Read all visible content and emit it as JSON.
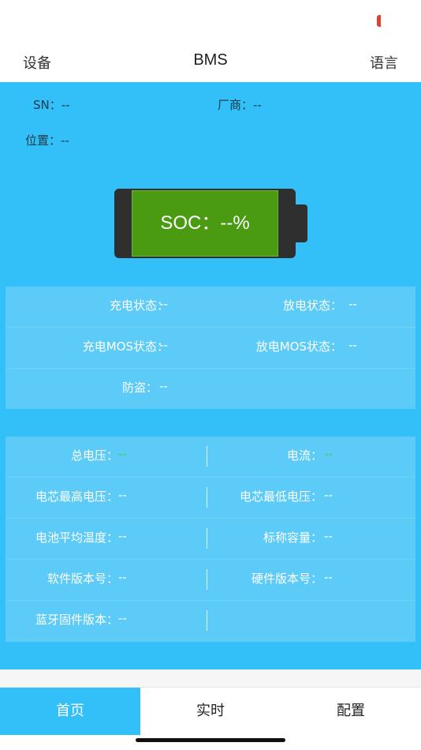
{
  "nav": {
    "left_label": "设备",
    "title": "BMS",
    "right_label": "语言"
  },
  "info": {
    "sn_label": "SN：",
    "sn_value": "--",
    "vendor_label": "厂商：",
    "vendor_value": "--",
    "location_label": "位置：",
    "location_value": "--"
  },
  "battery": {
    "soc_text": "SOC：--%",
    "fill_color": "#4a9a12"
  },
  "status_panel": [
    {
      "label": "充电状态：",
      "value": "--"
    },
    {
      "label": "放电状态：",
      "value": "--"
    },
    {
      "label": "充电MOS状态：",
      "value": "--"
    },
    {
      "label": "放电MOS状态：",
      "value": "--"
    },
    {
      "label": "防盗：",
      "value": "--"
    }
  ],
  "metrics_panel": [
    {
      "label": "总电压：",
      "value": "--"
    },
    {
      "label": "电流：",
      "value": "--"
    },
    {
      "label": "电芯最高电压：",
      "value": "--"
    },
    {
      "label": "电芯最低电压：",
      "value": "--"
    },
    {
      "label": "电池平均温度：",
      "value": "--"
    },
    {
      "label": "标称容量：",
      "value": "--"
    },
    {
      "label": "软件版本号：",
      "value": "--"
    },
    {
      "label": "硬件版本号：",
      "value": "--"
    },
    {
      "label": "蓝牙固件版本：",
      "value": "--"
    }
  ],
  "tabs": [
    {
      "label": "首页"
    },
    {
      "label": "实时"
    },
    {
      "label": "配置"
    }
  ],
  "colors": {
    "accent": "#33bff7",
    "panel": "#5ccbf7",
    "value_green": "#3fd23a"
  }
}
